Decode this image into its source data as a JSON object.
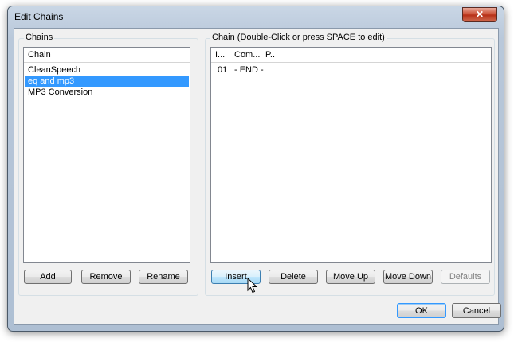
{
  "window": {
    "title": "Edit Chains",
    "close_symbol": "✕"
  },
  "chains_panel": {
    "group_label": "Chains",
    "column_header": "Chain",
    "items": [
      {
        "label": "CleanSpeech",
        "selected": false
      },
      {
        "label": "eq and mp3",
        "selected": true
      },
      {
        "label": "MP3 Conversion",
        "selected": false
      }
    ],
    "buttons": {
      "add": "Add",
      "remove": "Remove",
      "rename": "Rename"
    }
  },
  "chain_panel": {
    "group_label": "Chain (Double-Click or press SPACE to edit)",
    "columns": [
      "I...",
      "Com...",
      "P.."
    ],
    "rows": [
      {
        "index": "01",
        "command": "- END -",
        "params": ""
      }
    ],
    "buttons": {
      "insert": "Insert",
      "delete": "Delete",
      "move_up": "Move Up",
      "move_down": "Move Down",
      "defaults": "Defaults"
    }
  },
  "dialog_buttons": {
    "ok": "OK",
    "cancel": "Cancel"
  },
  "colors": {
    "selection": "#3399ff",
    "focus_border": "#3399ff"
  }
}
